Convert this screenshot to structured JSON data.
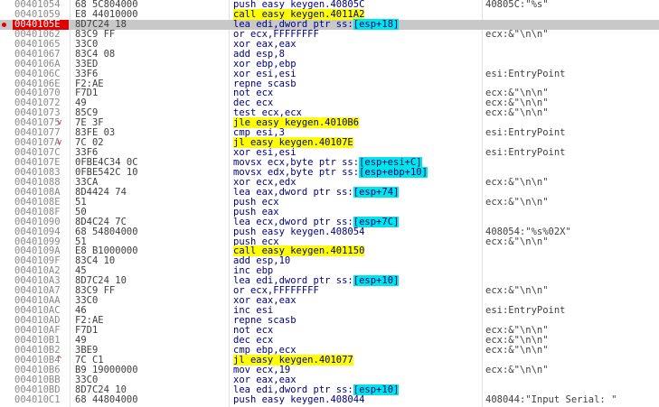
{
  "rows": [
    {
      "addr": "00401054",
      "arrow": "",
      "bytes": "68 5C804000",
      "pre": "push easy keygen.40805C",
      "hl": "",
      "post": "",
      "hlclass": "",
      "cmt": "40805C:\"%s\""
    },
    {
      "addr": "00401059",
      "arrow": "",
      "bytes": "E8 44010000",
      "pre": "",
      "hl": "call easy keygen.4011A2",
      "post": "",
      "hlclass": "y",
      "cmt": ""
    },
    {
      "addr": "0040105E",
      "arrow": "",
      "bytes": "8D7C24 18",
      "pre": "lea edi,dword ptr ss:",
      "hl": "[esp+18]",
      "post": "",
      "hlclass": "c",
      "cmt": "",
      "sel": true,
      "bp": true
    },
    {
      "addr": "00401062",
      "arrow": "",
      "bytes": "83C9 FF",
      "pre": "or ecx,FFFFFFFF",
      "hl": "",
      "post": "",
      "hlclass": "",
      "cmt": "ecx:&\"\\n\\n\""
    },
    {
      "addr": "00401065",
      "arrow": "",
      "bytes": "33C0",
      "pre": "xor eax,eax",
      "hl": "",
      "post": "",
      "hlclass": "",
      "cmt": ""
    },
    {
      "addr": "00401067",
      "arrow": "",
      "bytes": "83C4 08",
      "pre": "add esp,8",
      "hl": "",
      "post": "",
      "hlclass": "",
      "cmt": ""
    },
    {
      "addr": "0040106A",
      "arrow": "",
      "bytes": "33ED",
      "pre": "xor ebp,ebp",
      "hl": "",
      "post": "",
      "hlclass": "",
      "cmt": ""
    },
    {
      "addr": "0040106C",
      "arrow": "",
      "bytes": "33F6",
      "pre": "xor esi,esi",
      "hl": "",
      "post": "",
      "hlclass": "",
      "cmt": "esi:EntryPoint"
    },
    {
      "addr": "0040106E",
      "arrow": "",
      "bytes": "F2:AE",
      "pre": "repne scasb",
      "hl": "",
      "post": "",
      "hlclass": "",
      "cmt": ""
    },
    {
      "addr": "00401070",
      "arrow": "",
      "bytes": "F7D1",
      "pre": "not ecx",
      "hl": "",
      "post": "",
      "hlclass": "",
      "cmt": "ecx:&\"\\n\\n\""
    },
    {
      "addr": "00401072",
      "arrow": "",
      "bytes": "49",
      "pre": "dec ecx",
      "hl": "",
      "post": "",
      "hlclass": "",
      "cmt": "ecx:&\"\\n\\n\""
    },
    {
      "addr": "00401073",
      "arrow": "",
      "bytes": "85C9",
      "pre": "test ecx,ecx",
      "hl": "",
      "post": "",
      "hlclass": "",
      "cmt": "ecx:&\"\\n\\n\""
    },
    {
      "addr": "00401075",
      "arrow": "v",
      "bytes": "7E 3F",
      "pre": "",
      "hl": "jle easy keygen.4010B6",
      "post": "",
      "hlclass": "y",
      "cmt": ""
    },
    {
      "addr": "00401077",
      "arrow": "",
      "bytes": "83FE 03",
      "pre": "cmp esi,3",
      "hl": "",
      "post": "",
      "hlclass": "",
      "cmt": "esi:EntryPoint"
    },
    {
      "addr": "0040107A",
      "arrow": "v",
      "bytes": "7C 02",
      "pre": "",
      "hl": "jl easy keygen.40107E",
      "post": "",
      "hlclass": "y",
      "cmt": ""
    },
    {
      "addr": "0040107C",
      "arrow": "",
      "bytes": "33F6",
      "pre": "xor esi,esi",
      "hl": "",
      "post": "",
      "hlclass": "",
      "cmt": "esi:EntryPoint"
    },
    {
      "addr": "0040107E",
      "arrow": "",
      "bytes": "0FBE4C34 0C",
      "pre": "movsx ecx,byte ptr ss:",
      "hl": "[esp+esi+C]",
      "post": "",
      "hlclass": "c",
      "cmt": ""
    },
    {
      "addr": "00401083",
      "arrow": "",
      "bytes": "0FBE542C 10",
      "pre": "movsx edx,byte ptr ss:",
      "hl": "[esp+ebp+10]",
      "post": "",
      "hlclass": "c",
      "cmt": ""
    },
    {
      "addr": "00401088",
      "arrow": "",
      "bytes": "33CA",
      "pre": "xor ecx,edx",
      "hl": "",
      "post": "",
      "hlclass": "",
      "cmt": "ecx:&\"\\n\\n\""
    },
    {
      "addr": "0040108A",
      "arrow": "",
      "bytes": "8D4424 74",
      "pre": "lea eax,dword ptr ss:",
      "hl": "[esp+74]",
      "post": "",
      "hlclass": "c",
      "cmt": ""
    },
    {
      "addr": "0040108E",
      "arrow": "",
      "bytes": "51",
      "pre": "push ecx",
      "hl": "",
      "post": "",
      "hlclass": "",
      "cmt": "ecx:&\"\\n\\n\""
    },
    {
      "addr": "0040108F",
      "arrow": "",
      "bytes": "50",
      "pre": "push eax",
      "hl": "",
      "post": "",
      "hlclass": "",
      "cmt": ""
    },
    {
      "addr": "00401090",
      "arrow": "",
      "bytes": "8D4C24 7C",
      "pre": "lea ecx,dword ptr ss:",
      "hl": "[esp+7C]",
      "post": "",
      "hlclass": "c",
      "cmt": ""
    },
    {
      "addr": "00401094",
      "arrow": "",
      "bytes": "68 54804000",
      "pre": "push easy keygen.408054",
      "hl": "",
      "post": "",
      "hlclass": "",
      "cmt": "408054:\"%s%02X\""
    },
    {
      "addr": "00401099",
      "arrow": "",
      "bytes": "51",
      "pre": "push ecx",
      "hl": "",
      "post": "",
      "hlclass": "",
      "cmt": "ecx:&\"\\n\\n\""
    },
    {
      "addr": "0040109A",
      "arrow": "",
      "bytes": "E8 B1000000",
      "pre": "",
      "hl": "call easy keygen.401150",
      "post": "",
      "hlclass": "y",
      "cmt": ""
    },
    {
      "addr": "0040109F",
      "arrow": "",
      "bytes": "83C4 10",
      "pre": "add esp,10",
      "hl": "",
      "post": "",
      "hlclass": "",
      "cmt": ""
    },
    {
      "addr": "004010A2",
      "arrow": "",
      "bytes": "45",
      "pre": "inc ebp",
      "hl": "",
      "post": "",
      "hlclass": "",
      "cmt": ""
    },
    {
      "addr": "004010A3",
      "arrow": "",
      "bytes": "8D7C24 10",
      "pre": "lea edi,dword ptr ss:",
      "hl": "[esp+10]",
      "post": "",
      "hlclass": "c",
      "cmt": ""
    },
    {
      "addr": "004010A7",
      "arrow": "",
      "bytes": "83C9 FF",
      "pre": "or ecx,FFFFFFFF",
      "hl": "",
      "post": "",
      "hlclass": "",
      "cmt": "ecx:&\"\\n\\n\""
    },
    {
      "addr": "004010AA",
      "arrow": "",
      "bytes": "33C0",
      "pre": "xor eax,eax",
      "hl": "",
      "post": "",
      "hlclass": "",
      "cmt": ""
    },
    {
      "addr": "004010AC",
      "arrow": "",
      "bytes": "46",
      "pre": "inc esi",
      "hl": "",
      "post": "",
      "hlclass": "",
      "cmt": "esi:EntryPoint"
    },
    {
      "addr": "004010AD",
      "arrow": "",
      "bytes": "F2:AE",
      "pre": "repne scasb",
      "hl": "",
      "post": "",
      "hlclass": "",
      "cmt": ""
    },
    {
      "addr": "004010AF",
      "arrow": "",
      "bytes": "F7D1",
      "pre": "not ecx",
      "hl": "",
      "post": "",
      "hlclass": "",
      "cmt": "ecx:&\"\\n\\n\""
    },
    {
      "addr": "004010B1",
      "arrow": "",
      "bytes": "49",
      "pre": "dec ecx",
      "hl": "",
      "post": "",
      "hlclass": "",
      "cmt": "ecx:&\"\\n\\n\""
    },
    {
      "addr": "004010B2",
      "arrow": "",
      "bytes": "3BE9",
      "pre": "cmp ebp,ecx",
      "hl": "",
      "post": "",
      "hlclass": "",
      "cmt": "ecx:&\"\\n\\n\""
    },
    {
      "addr": "004010B4",
      "arrow": "^",
      "bytes": "7C C1",
      "pre": "",
      "hl": "jl easy keygen.401077",
      "post": "",
      "hlclass": "y",
      "cmt": ""
    },
    {
      "addr": "004010B6",
      "arrow": "",
      "bytes": "B9 19000000",
      "pre": "mov ecx,19",
      "hl": "",
      "post": "",
      "hlclass": "",
      "cmt": "ecx:&\"\\n\\n\""
    },
    {
      "addr": "004010BB",
      "arrow": "",
      "bytes": "33C0",
      "pre": "xor eax,eax",
      "hl": "",
      "post": "",
      "hlclass": "",
      "cmt": ""
    },
    {
      "addr": "004010BD",
      "arrow": "",
      "bytes": "8D7C24 10",
      "pre": "lea edi,dword ptr ss:",
      "hl": "[esp+10]",
      "post": "",
      "hlclass": "c",
      "cmt": ""
    },
    {
      "addr": "004010C1",
      "arrow": "",
      "bytes": "68 44804000",
      "pre": "push easy keygen.408044",
      "hl": "",
      "post": "",
      "hlclass": "",
      "cmt": "408044:\"Input Serial: \""
    }
  ]
}
